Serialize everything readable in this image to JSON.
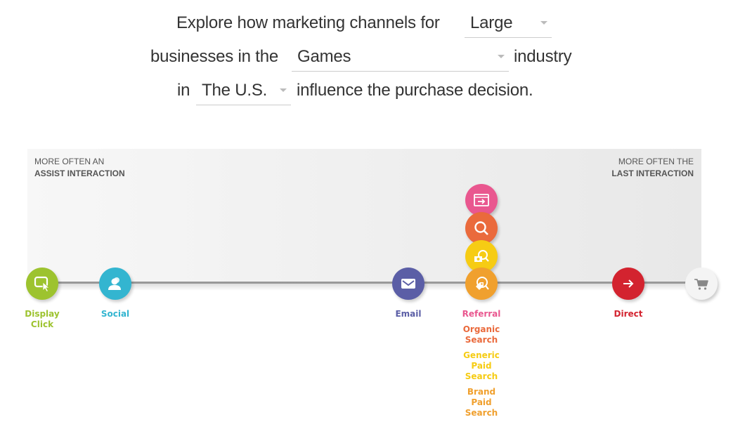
{
  "sentence": {
    "part1": "Explore how marketing channels for",
    "part2": "businesses in the",
    "part3": "industry",
    "part4": "in",
    "part5": "influence the purchase decision.",
    "business_size": "Large",
    "industry": "Games",
    "country": "The U.S."
  },
  "axis": {
    "left_line1": "MORE OFTEN AN",
    "left_line2": "ASSIST INTERACTION",
    "right_line1": "MORE OFTEN THE",
    "right_line2": "LAST INTERACTION"
  },
  "channels": [
    {
      "name": "Display Click",
      "label_lines": [
        "Display",
        "Click"
      ],
      "color": "#9dc32f",
      "icon": "display-click-icon"
    },
    {
      "name": "Social",
      "label_lines": [
        "Social"
      ],
      "color": "#33b5d0",
      "icon": "social-icon"
    },
    {
      "name": "Email",
      "label_lines": [
        "Email"
      ],
      "color": "#5b5ea6",
      "icon": "email-icon"
    },
    {
      "name": "Referral",
      "label_lines": [
        "Referral"
      ],
      "color": "#e9578f",
      "icon": "referral-icon"
    },
    {
      "name": "Organic Search",
      "label_lines": [
        "Organic",
        "Search"
      ],
      "color": "#ea6a3c",
      "icon": "organic-search-icon"
    },
    {
      "name": "Generic Paid Search",
      "label_lines": [
        "Generic",
        "Paid",
        "Search"
      ],
      "color": "#f6cc14",
      "icon": "generic-paid-search-icon"
    },
    {
      "name": "Brand Paid Search",
      "label_lines": [
        "Brand",
        "Paid",
        "Search"
      ],
      "color": "#f0a02e",
      "icon": "brand-paid-search-icon"
    },
    {
      "name": "Direct",
      "label_lines": [
        "Direct"
      ],
      "color": "#d3232f",
      "icon": "direct-icon"
    }
  ],
  "endpoint": {
    "icon": "cart-icon",
    "color": "#f4f4f4"
  }
}
